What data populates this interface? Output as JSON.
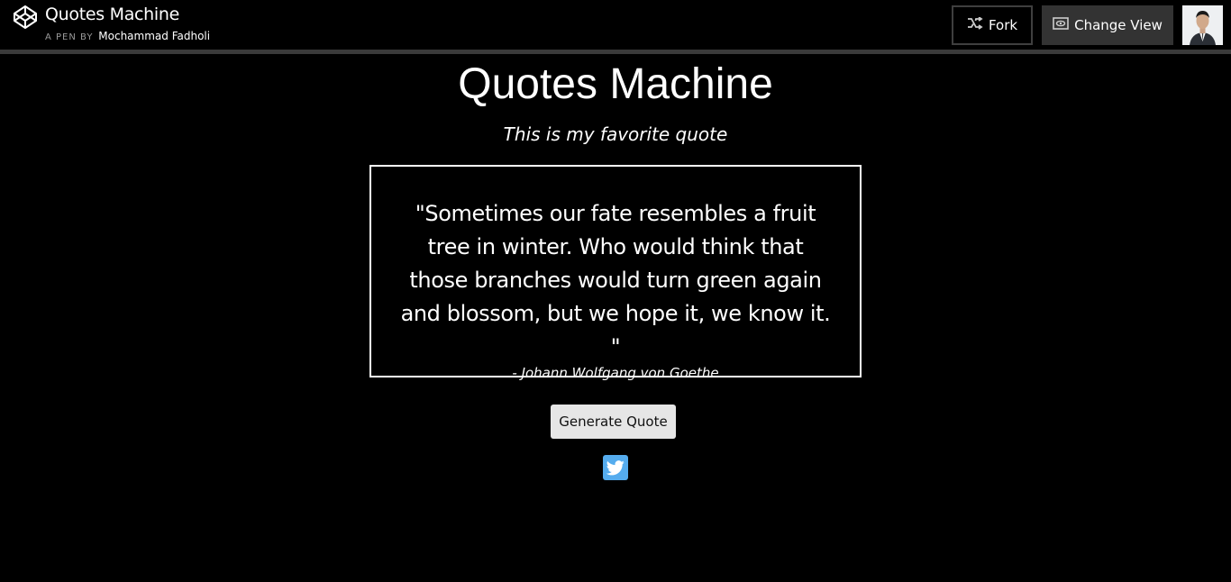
{
  "header": {
    "pen_title": "Quotes Machine",
    "pen_by_prefix": "A PEN BY",
    "author": "Mochammad Fadholi",
    "fork_label": "Fork",
    "change_view_label": "Change View",
    "icons": {
      "logo": "codepen-icon",
      "fork": "fork-icon",
      "view": "eye-icon",
      "avatar": "user-avatar"
    }
  },
  "main": {
    "title": "Quotes Machine",
    "subtitle": "This is my favorite quote",
    "quote": "\"Sometimes our fate resembles a fruit tree in winter. Who would think that those branches would turn green again and blossom, but we hope it, we know it. \"",
    "author": "- Johann Wolfgang von Goethe",
    "generate_label": "Generate Quote",
    "tweet_icon": "twitter-icon"
  },
  "colors": {
    "background": "#000000",
    "twitter": "#55acee",
    "button": "#e6e6e6"
  }
}
